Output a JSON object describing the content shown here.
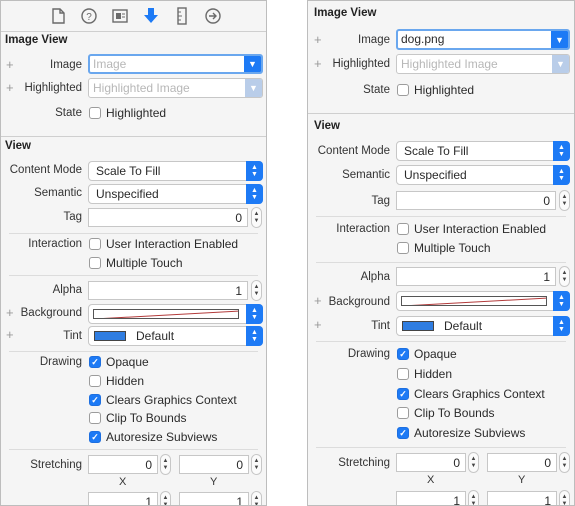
{
  "toolbar": {
    "icons": [
      "file-icon",
      "help-icon",
      "identity-icon",
      "attributes-icon",
      "size-icon",
      "connections-icon"
    ]
  },
  "left": {
    "image_view": {
      "header": "Image View",
      "image_label": "Image",
      "image_placeholder": "Image",
      "highlighted_label": "Highlighted",
      "highlighted_placeholder": "Highlighted Image",
      "state_label": "State",
      "state_highlighted": "Highlighted"
    },
    "view": {
      "header": "View",
      "content_mode_label": "Content Mode",
      "content_mode_value": "Scale To Fill",
      "semantic_label": "Semantic",
      "semantic_value": "Unspecified",
      "tag_label": "Tag",
      "tag_value": "0",
      "interaction_label": "Interaction",
      "user_interaction": "User Interaction Enabled",
      "multiple_touch": "Multiple Touch",
      "alpha_label": "Alpha",
      "alpha_value": "1",
      "background_label": "Background",
      "tint_label": "Tint",
      "tint_value": "Default",
      "drawing_label": "Drawing",
      "opaque": "Opaque",
      "hidden": "Hidden",
      "clears": "Clears Graphics Context",
      "clip": "Clip To Bounds",
      "autoresize": "Autoresize Subviews",
      "stretching_label": "Stretching",
      "stretch_x": "0",
      "stretch_y": "0",
      "x_label": "X",
      "y_label": "Y",
      "stretch_w": "1",
      "stretch_h": "1"
    }
  },
  "right": {
    "image_view": {
      "header": "Image View",
      "image_label": "Image",
      "image_value": "dog.png",
      "highlighted_label": "Highlighted",
      "highlighted_placeholder": "Highlighted Image",
      "state_label": "State",
      "state_highlighted": "Highlighted"
    },
    "view": {
      "header": "View",
      "content_mode_label": "Content Mode",
      "content_mode_value": "Scale To Fill",
      "semantic_label": "Semantic",
      "semantic_value": "Unspecified",
      "tag_label": "Tag",
      "tag_value": "0",
      "interaction_label": "Interaction",
      "user_interaction": "User Interaction Enabled",
      "multiple_touch": "Multiple Touch",
      "alpha_label": "Alpha",
      "alpha_value": "1",
      "background_label": "Background",
      "tint_label": "Tint",
      "tint_value": "Default",
      "drawing_label": "Drawing",
      "opaque": "Opaque",
      "hidden": "Hidden",
      "clears": "Clears Graphics Context",
      "clip": "Clip To Bounds",
      "autoresize": "Autoresize Subviews",
      "stretching_label": "Stretching",
      "stretch_x": "0",
      "stretch_y": "0",
      "x_label": "X",
      "y_label": "Y",
      "stretch_w": "1",
      "stretch_h": "1"
    }
  },
  "checkbox_states": {
    "highlighted": false,
    "user_interaction": false,
    "multiple_touch": false,
    "opaque": true,
    "hidden": false,
    "clears": true,
    "clip": false,
    "autoresize": true
  },
  "colors": {
    "accent": "#1d7af5",
    "tint_swatch": "#2f7de1",
    "background_slash": "#b23a3a"
  }
}
